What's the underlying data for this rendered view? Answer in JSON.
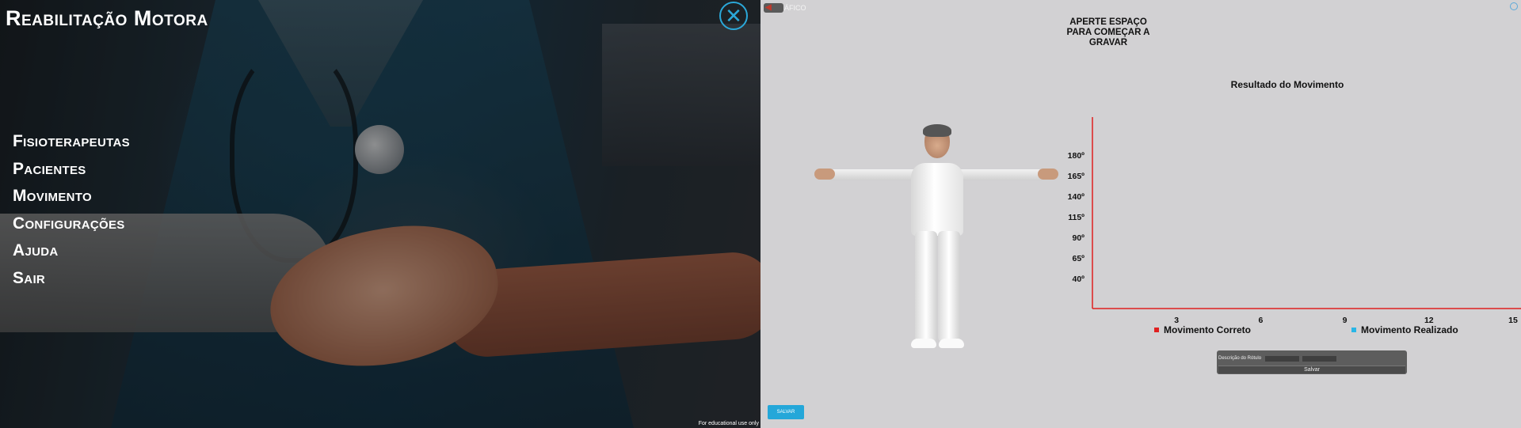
{
  "left_panel": {
    "title": "Reabilitação Motora",
    "close_icon": "close-icon",
    "menu": [
      {
        "label": "Fisioterapeutas"
      },
      {
        "label": "Pacientes"
      },
      {
        "label": "Movimento"
      },
      {
        "label": "Configurações"
      },
      {
        "label": "Ajuda"
      },
      {
        "label": "Sair"
      }
    ],
    "watermark": "For educational use only",
    "accent": "#2ba8d9"
  },
  "right_panel": {
    "back_icon": "back-arrow-icon",
    "back_label": "ÁFICO",
    "instruction": "APERTE ESPAÇO PARA COMEÇAR A GRAVAR",
    "label_form": {
      "caption": "Descrição do Rótulo",
      "input1_value": "",
      "input2_value": "",
      "save_label": "Salvar"
    },
    "save_button": "SALVAR",
    "background": "#d2d1d3"
  },
  "chart_data": {
    "type": "line",
    "title": "Resultado do Movimento",
    "x_ticks": [
      3,
      6,
      9,
      12,
      15
    ],
    "y_ticks": [
      "40º",
      "65º",
      "90º",
      "115º",
      "140º",
      "165º",
      "180º"
    ],
    "y_values": [
      40,
      65,
      90,
      115,
      140,
      165,
      180
    ],
    "series": [
      {
        "name": "Movimento Correto",
        "color": "#e02020",
        "values": []
      },
      {
        "name": "Movimento Realizado",
        "color": "#29b6e6",
        "values": []
      }
    ],
    "axis_color": "#e02020",
    "legend_position": "bottom",
    "grid": false
  }
}
